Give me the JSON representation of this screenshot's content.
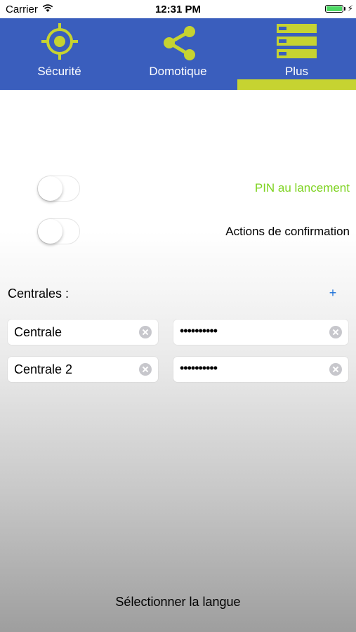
{
  "status_bar": {
    "carrier": "Carrier",
    "time": "12:31 PM"
  },
  "tabs": [
    {
      "label": "Sécurité",
      "icon": "target-icon"
    },
    {
      "label": "Domotique",
      "icon": "share-icon"
    },
    {
      "label": "Plus",
      "icon": "server-list-icon",
      "selected": true
    }
  ],
  "settings": {
    "pin_label": "PIN au lancement",
    "pin_enabled": false,
    "confirm_label": "Actions de confirmation",
    "confirm_enabled": false
  },
  "centrales": {
    "title": "Centrales :",
    "add_label": "+",
    "items": [
      {
        "name": "Centrale",
        "password": "••••••••••"
      },
      {
        "name": "Centrale 2",
        "password": "••••••••••"
      }
    ]
  },
  "footer": {
    "language_button": "Sélectionner la langue"
  },
  "colors": {
    "tab_bar": "#3a5ebd",
    "accent": "#c6d331",
    "pin_label": "#7ed321",
    "add_button": "#1a6fd8"
  }
}
